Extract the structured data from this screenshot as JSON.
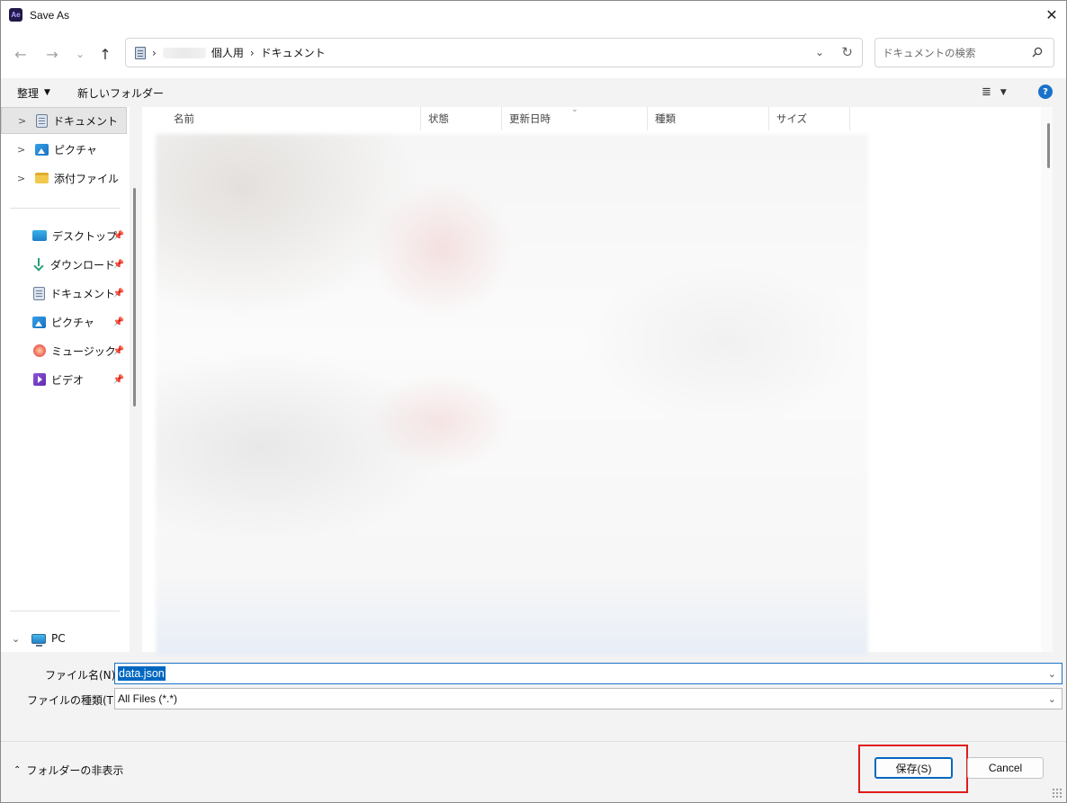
{
  "window": {
    "title": "Save As",
    "app_icon_text": "Ae",
    "close_glyph": "✕"
  },
  "nav": {
    "back_glyph": "←",
    "forward_glyph": "→",
    "recent_glyph": "⌄",
    "up_glyph": "↑",
    "breadcrumb": [
      {
        "label": "個人用"
      },
      {
        "label": "ドキュメント"
      }
    ],
    "breadcrumb_sep": "›",
    "dropdown_glyph": "⌄",
    "refresh_glyph": "↻",
    "search_placeholder": "ドキュメントの検索"
  },
  "toolbar": {
    "organize_label": "整理",
    "new_folder_label": "新しいフォルダー",
    "view_glyph": "≣",
    "help_glyph": "?"
  },
  "sidebar": {
    "tree": [
      {
        "label": "ドキュメント",
        "icon": "document-icon",
        "selected": true
      },
      {
        "label": "ピクチャ",
        "icon": "pictures-icon"
      },
      {
        "label": "添付ファイル",
        "icon": "folder-icon"
      }
    ],
    "quick_access": [
      {
        "label": "デスクトップ",
        "icon": "desktop-icon"
      },
      {
        "label": "ダウンロード",
        "icon": "download-icon"
      },
      {
        "label": "ドキュメント",
        "icon": "document-icon"
      },
      {
        "label": "ピクチャ",
        "icon": "pictures-icon"
      },
      {
        "label": "ミュージック",
        "icon": "music-icon"
      },
      {
        "label": "ビデオ",
        "icon": "video-icon"
      }
    ],
    "pc_label": "PC",
    "pin_glyph": "📌"
  },
  "filelist": {
    "columns": [
      {
        "label": "名前"
      },
      {
        "label": "状態"
      },
      {
        "label": "更新日時"
      },
      {
        "label": "種類"
      },
      {
        "label": "サイズ"
      }
    ],
    "sort_glyph": "⌄"
  },
  "fields": {
    "filename_label": "ファイル名(N):",
    "filename_value": "data.json",
    "filetype_label": "ファイルの種類(T):",
    "filetype_value": "All Files (*.*)"
  },
  "footer": {
    "hide_folders_label": "フォルダーの非表示",
    "save_label": "保存(S)",
    "cancel_label": "Cancel"
  },
  "colors": {
    "accent": "#0067c0",
    "highlight": "#e01b1b",
    "help": "#1a73c9"
  }
}
